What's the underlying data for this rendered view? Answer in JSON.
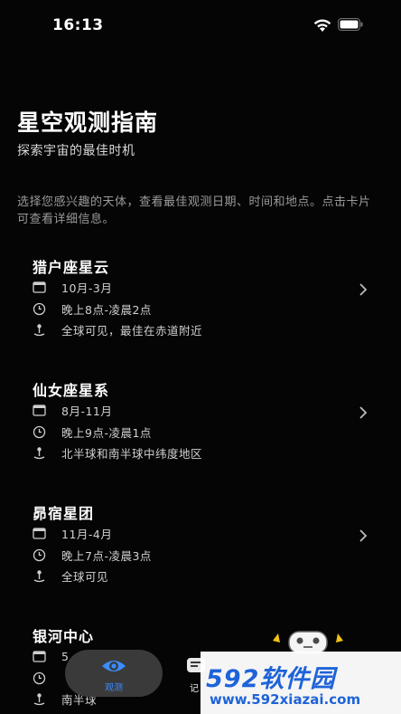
{
  "status_bar": {
    "time": "16:13"
  },
  "header": {
    "title": "星空观测指南",
    "subtitle": "探索宇宙的最佳时机",
    "intro": "选择您感兴趣的天体，查看最佳观测日期、时间和地点。点击卡片可查看详细信息。"
  },
  "targets": [
    {
      "name": "猎户座星云",
      "months": "10月-3月",
      "hours": "晚上8点-凌晨2点",
      "location": "全球可见，最佳在赤道附近"
    },
    {
      "name": "仙女座星系",
      "months": "8月-11月",
      "hours": "晚上9点-凌晨1点",
      "location": "北半球和南半球中纬度地区"
    },
    {
      "name": "昴宿星团",
      "months": "11月-4月",
      "hours": "晚上7点-凌晨3点",
      "location": "全球可见"
    },
    {
      "name": "银河中心",
      "months": "5",
      "hours": "",
      "location": "南半球"
    }
  ],
  "tabs": [
    {
      "label": "观测",
      "icon": "eye-icon",
      "active": true
    },
    {
      "label": "记",
      "icon": "journal-icon",
      "active": false
    }
  ],
  "watermark": {
    "logo": "592软件园",
    "url": "www.592xiazai.com"
  },
  "colors": {
    "background": "#050505",
    "accent": "#3b8cff",
    "tab_active_bg": "#3a3a3a",
    "watermark_blue": "#1e63d9"
  }
}
